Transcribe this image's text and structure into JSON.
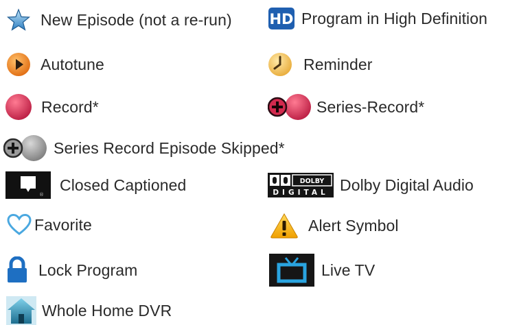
{
  "legend": {
    "items": [
      {
        "icon": "star-icon",
        "label": "New Episode (not a re-run)"
      },
      {
        "icon": "hd-icon",
        "label": "Program in High Definition",
        "badge": "HD"
      },
      {
        "icon": "autotune-icon",
        "label": "Autotune"
      },
      {
        "icon": "reminder-clock-icon",
        "label": "Reminder"
      },
      {
        "icon": "record-icon",
        "label": "Record*"
      },
      {
        "icon": "series-record-icon",
        "label": "Series-Record*"
      },
      {
        "icon": "series-record-skipped-icon",
        "label": "Series Record Episode Skipped*"
      },
      {
        "icon": "closed-captioned-icon",
        "label": "Closed Captioned",
        "mark": "®"
      },
      {
        "icon": "dolby-digital-icon",
        "label": "Dolby Digital Audio",
        "badge_top": "DOLBY",
        "badge_bottom": "DIGITAL"
      },
      {
        "icon": "favorite-heart-icon",
        "label": "Favorite"
      },
      {
        "icon": "alert-icon",
        "label": "Alert Symbol"
      },
      {
        "icon": "lock-icon",
        "label": "Lock Program"
      },
      {
        "icon": "live-tv-icon",
        "label": "Live TV"
      },
      {
        "icon": "whole-home-dvr-icon",
        "label": "Whole Home DVR"
      }
    ]
  },
  "colors": {
    "text": "#2a2a2a",
    "star_blue": "#2f7fc2",
    "hd_blue": "#1f5fb0",
    "autotune_orange": "#e8801c",
    "reminder_yellow": "#f2c14a",
    "record_red": "#c8234a",
    "skipped_gray": "#8c8c8c",
    "caption_black": "#111111",
    "heart_blue": "#4aa8e0",
    "alert_yellow": "#f5b400",
    "lock_blue": "#1e6fc2",
    "live_tv_blue": "#2aa4e0",
    "home_teal": "#1d8fb0"
  }
}
